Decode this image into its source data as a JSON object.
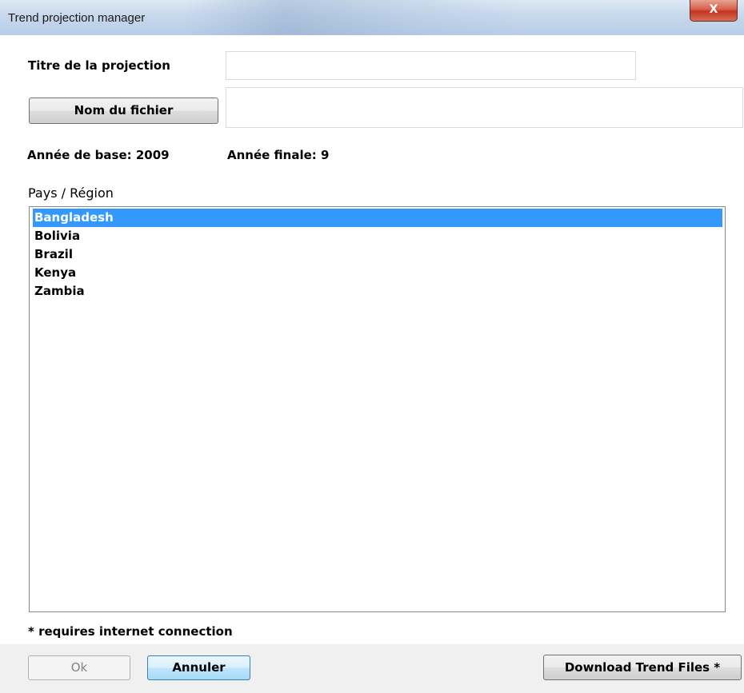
{
  "window": {
    "title": "Trend projection manager",
    "close_glyph": "X"
  },
  "form": {
    "title_label": "Titre de la projection",
    "title_value": "",
    "filename_button": "Nom du fichier",
    "filename_value": "",
    "base_year_label": "Année de base: 2009",
    "final_year_label": "Année finale: 9",
    "country_list_label": "Pays / Région",
    "countries": [
      {
        "name": "Bangladesh",
        "selected": true
      },
      {
        "name": "Bolivia",
        "selected": false
      },
      {
        "name": "Brazil",
        "selected": false
      },
      {
        "name": "Kenya",
        "selected": false
      },
      {
        "name": "Zambia",
        "selected": false
      }
    ],
    "note": "* requires internet connection"
  },
  "buttons": {
    "ok": "Ok",
    "cancel": "Annuler",
    "download": "Download Trend Files *"
  },
  "colors": {
    "selection": "#3399ff",
    "titlebar": "#c7d8ec",
    "close": "#c2331c"
  }
}
